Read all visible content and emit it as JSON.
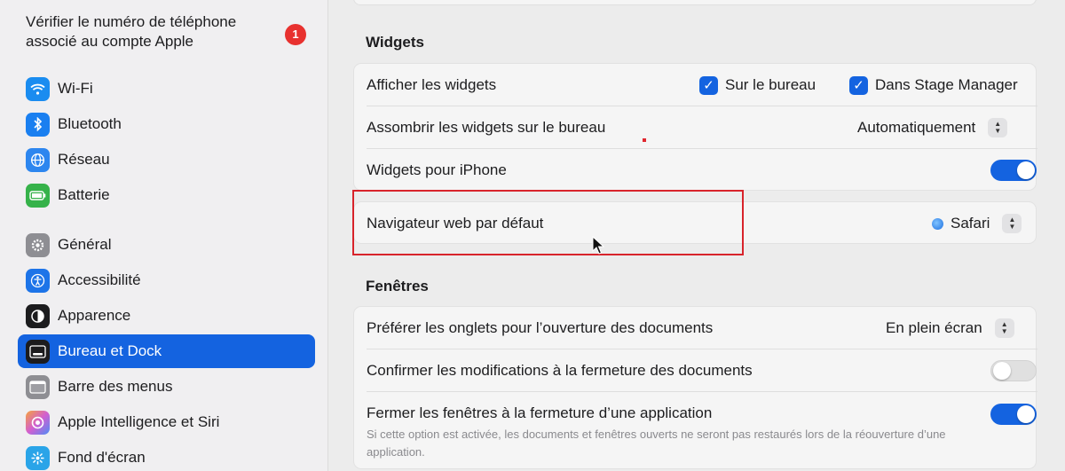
{
  "sidebar": {
    "notice_text": "Vérifier le numéro de téléphone associé au compte Apple",
    "notice_badge": "1",
    "items": [
      {
        "label": "Wi-Fi",
        "icon": "wifi-icon",
        "color": "#1a8cf0"
      },
      {
        "label": "Bluetooth",
        "icon": "bluetooth-icon",
        "color": "#1a7ff0"
      },
      {
        "label": "Réseau",
        "icon": "globe-icon",
        "color": "#2d86ef"
      },
      {
        "label": "Batterie",
        "icon": "battery-icon",
        "color": "#36b24a"
      },
      {
        "label": "Général",
        "icon": "gear-icon",
        "color": "#8e8e93"
      },
      {
        "label": "Accessibilité",
        "icon": "accessibility-icon",
        "color": "#1d74e8"
      },
      {
        "label": "Apparence",
        "icon": "appearance-icon",
        "color": "#1c1c1e"
      },
      {
        "label": "Bureau et Dock",
        "icon": "desktop-dock-icon",
        "color": "#1c1c1e",
        "active": true
      },
      {
        "label": "Barre des menus",
        "icon": "menubar-icon",
        "color": "#8e8e93"
      },
      {
        "label": "Apple Intelligence et Siri",
        "icon": "siri-icon",
        "color": "#d35fd0"
      },
      {
        "label": "Fond d'écran",
        "icon": "wallpaper-icon",
        "color": "#2aa4e8"
      }
    ]
  },
  "main": {
    "widgets_title": "Widgets",
    "show_widgets_label": "Afficher les widgets",
    "on_desktop_label": "Sur le bureau",
    "stage_manager_label": "Dans Stage Manager",
    "dim_widgets_label": "Assombrir les widgets sur le bureau",
    "dim_widgets_value": "Automatiquement",
    "iphone_widgets_label": "Widgets pour iPhone",
    "iphone_widgets_on": true,
    "default_browser_label": "Navigateur web par défaut",
    "default_browser_value": "Safari",
    "windows_title": "Fenêtres",
    "prefer_tabs_label": "Préférer les onglets pour l’ouverture des documents",
    "prefer_tabs_value": "En plein écran",
    "confirm_changes_label": "Confirmer les modifications à la fermeture des documents",
    "confirm_changes_on": false,
    "close_windows_label": "Fermer les fenêtres à la fermeture d’une application",
    "close_windows_on": true,
    "close_windows_desc": "Si cette option est activée, les documents et fenêtres ouverts ne seront pas restaurés lors de la réouverture d’une application."
  },
  "colors": {
    "accent": "#1463e0",
    "highlight": "#d8232b",
    "badge": "#e8312f"
  }
}
